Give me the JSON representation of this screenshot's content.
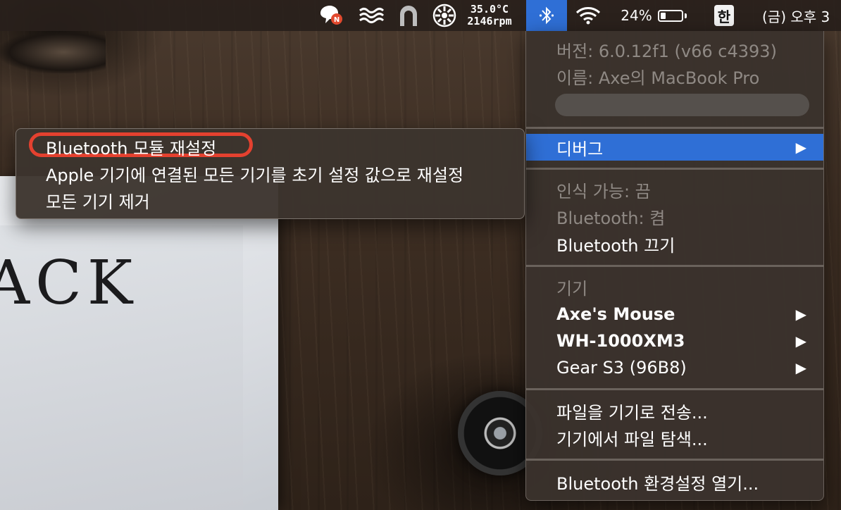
{
  "colors": {
    "accent": "#2f6fd6",
    "annotation": "#e4412f"
  },
  "menubar": {
    "icons": [
      "chat-notification-icon",
      "wind-icon",
      "arch-icon",
      "fan-icon",
      "bluetooth-icon",
      "wifi-icon"
    ],
    "notification_badge": "N",
    "temp": "35.0°C",
    "fan_rpm": "2146rpm",
    "battery_percent": "24%",
    "battery_level": 0.24,
    "input_method": "한",
    "clock": "(금) 오후 3"
  },
  "bluetooth_menu": {
    "version": "버전: 6.0.12f1 (v66 c4393)",
    "name": "이름: Axe의 MacBook Pro",
    "debug": "디버그",
    "discoverable": "인식 가능: 끔",
    "bluetooth_status": "Bluetooth: 켬",
    "turn_off": "Bluetooth 끄기",
    "devices_header": "기기",
    "devices": [
      {
        "name": "Axe's Mouse"
      },
      {
        "name": "WH-1000XM3"
      },
      {
        "name": "Gear S3 (96B8)"
      }
    ],
    "send_file": "파일을 기기로 전송...",
    "browse_files": "기기에서 파일 탐색...",
    "open_prefs": "Bluetooth 환경설정 열기...",
    "arrow": "▶"
  },
  "debug_submenu": {
    "items": [
      "Bluetooth 모듈 재설정",
      "Apple 기기에 연결된 모든 기기를 초기 설정 값으로 재설정",
      "모든 기기 제거"
    ]
  },
  "wallpaper": {
    "paper_text": "ACK"
  }
}
